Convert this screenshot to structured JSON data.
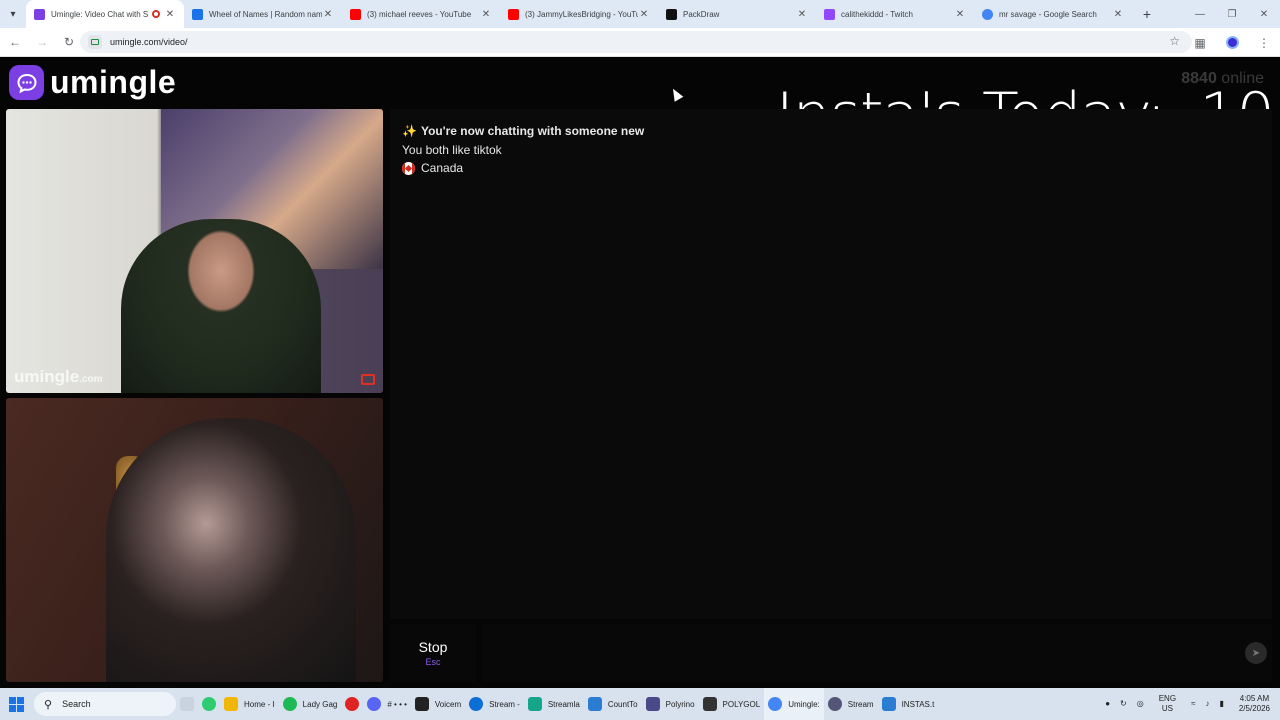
{
  "browser": {
    "tabs": [
      {
        "title": "Umingle: Video Chat with S",
        "active": true,
        "color": "#7b3fe4",
        "recording": true
      },
      {
        "title": "Wheel of Names | Random nam",
        "color": "#1a73e8"
      },
      {
        "title": "(3) michael reeves - YouTube",
        "color": "#ff0000"
      },
      {
        "title": "(3) JammyLikesBridging - YouTu",
        "color": "#ff0000"
      },
      {
        "title": "PackDraw",
        "color": "#111111"
      },
      {
        "title": "calithekiddd - Twitch",
        "color": "#9146ff"
      },
      {
        "title": "mr savage - Google Search",
        "color": "#4285f4"
      }
    ],
    "new_tab_icon": "+",
    "url": "umingle.com/video/"
  },
  "page": {
    "logo_text": "umingle",
    "overlay_count": "8840",
    "overlay_suffix": "online",
    "insta_label": "Insta's Today:",
    "insta_count": "10",
    "watermark_main": "umingle",
    "watermark_suffix": ".com",
    "chat": {
      "line1": "You're now chatting with someone new",
      "line2": "You both like tiktok",
      "line3": "Canada"
    },
    "stop_label": "Stop",
    "stop_key": "Esc",
    "message_placeholder": ""
  },
  "taskbar": {
    "search_label": "Search",
    "items": [
      {
        "label": "",
        "color": "#c9d3df"
      },
      {
        "label": "",
        "color": "#2ecc71"
      },
      {
        "label": "Home - I",
        "color": "#f2b705"
      },
      {
        "label": "Lady Gag",
        "color": "#1db954"
      },
      {
        "label": "",
        "color": "#e02424"
      },
      {
        "label": "# • • •",
        "color": "#5865f2"
      },
      {
        "label": "Voicem",
        "color": "#222222"
      },
      {
        "label": "Stream -",
        "color": "#0b6fd6"
      },
      {
        "label": "Streamla",
        "color": "#17a589"
      },
      {
        "label": "CountTo",
        "color": "#2b7cd3"
      },
      {
        "label": "Polyrino",
        "color": "#4a4a8a"
      },
      {
        "label": "POLYGOL",
        "color": "#333333"
      },
      {
        "label": "Umingle:",
        "color": "#4285f4"
      },
      {
        "label": "Stream",
        "color": "#555577"
      },
      {
        "label": "INSTAS.t",
        "color": "#2b7cd3"
      }
    ],
    "lang_top": "ENG",
    "lang_bottom": "US",
    "time": "4:05 AM",
    "date": "2/5/2026"
  }
}
